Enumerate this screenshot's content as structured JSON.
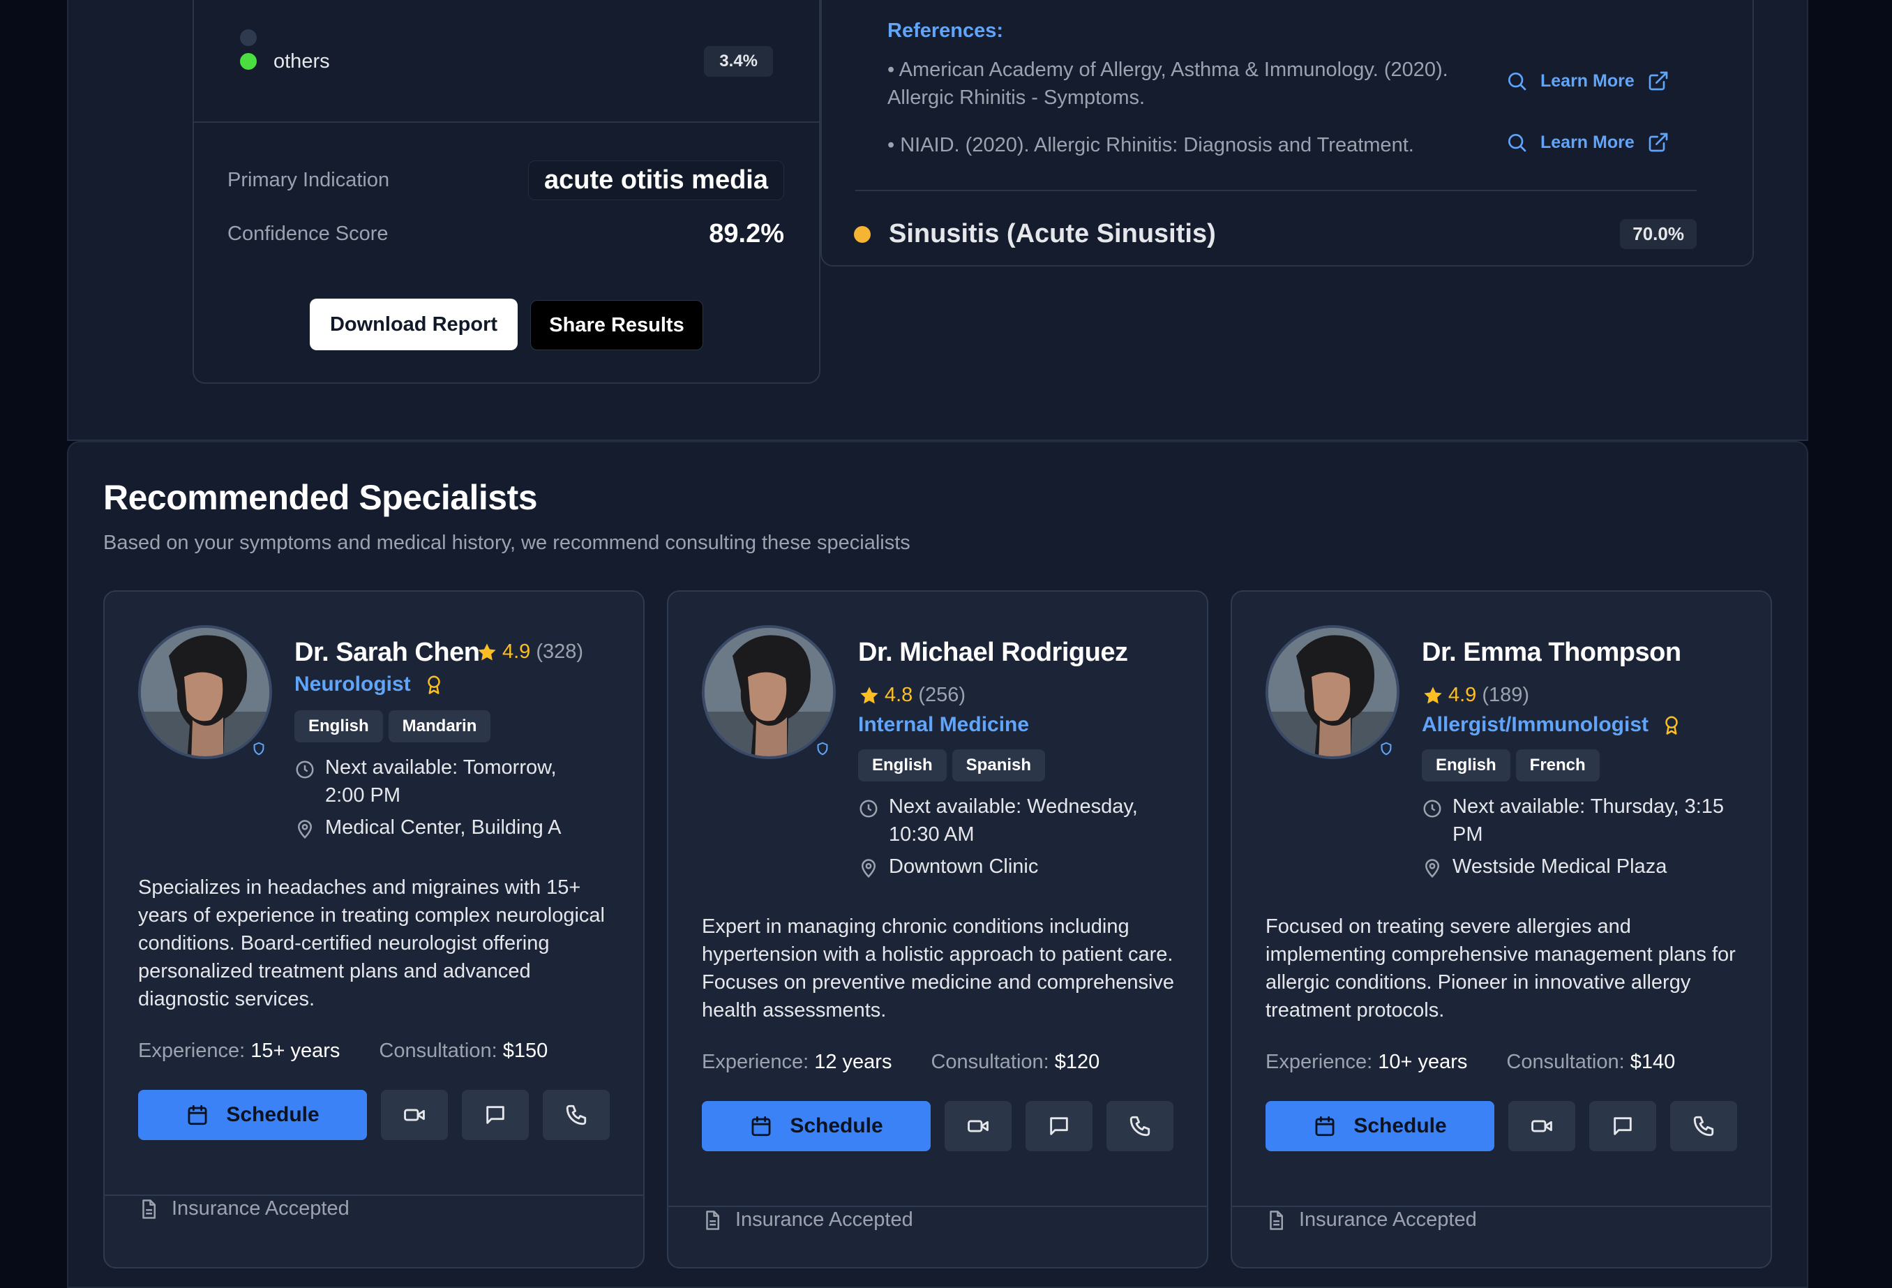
{
  "results": {
    "conditions": [
      {
        "name": "others",
        "percent": "3.4%",
        "color": "#4ade40"
      }
    ],
    "primary_indication_label": "Primary Indication",
    "primary_indication_value": "acute otitis media",
    "confidence_label": "Confidence Score",
    "confidence_value": "89.2%",
    "download_label": "Download Report",
    "share_label": "Share Results"
  },
  "references": {
    "title": "References:",
    "items": [
      {
        "text": "• American Academy of Allergy, Asthma & Immunology. (2020). Allergic Rhinitis - Symptoms.",
        "link_label": "Learn More"
      },
      {
        "text": "• NIAID. (2020). Allergic Rhinitis: Diagnosis and Treatment.",
        "link_label": "Learn More"
      }
    ],
    "next_condition": {
      "name": "Sinusitis (Acute Sinusitis)",
      "percent": "70.0%",
      "color": "#f5b533"
    }
  },
  "specialists": {
    "title": "Recommended Specialists",
    "subtitle": "Based on your symptoms and medical history, we recommend consulting these specialists",
    "doctors": [
      {
        "name": "Dr. Sarah Chen",
        "rating": "4.9",
        "reviews": "(328)",
        "specialty": "Neurologist",
        "languages": [
          "English",
          "Mandarin"
        ],
        "availability": "Next available: Tomorrow, 2:00 PM",
        "location": "Medical Center, Building A",
        "description": "Specializes in headaches and migraines with 15+ years of experience in treating complex neurological conditions. Board-certified neurologist offering personalized treatment plans and advanced diagnostic services.",
        "experience_label": "Experience:",
        "experience": "15+ years",
        "consultation_label": "Consultation:",
        "consultation": "$150",
        "schedule_label": "Schedule",
        "insurance": "Insurance Accepted"
      },
      {
        "name": "Dr. Michael Rodriguez",
        "rating": "4.8",
        "reviews": "(256)",
        "specialty": "Internal Medicine",
        "languages": [
          "English",
          "Spanish"
        ],
        "availability": "Next available: Wednesday, 10:30 AM",
        "location": "Downtown Clinic",
        "description": "Expert in managing chronic conditions including hypertension with a holistic approach to patient care. Focuses on preventive medicine and comprehensive health assessments.",
        "experience_label": "Experience:",
        "experience": "12 years",
        "consultation_label": "Consultation:",
        "consultation": "$120",
        "schedule_label": "Schedule",
        "insurance": "Insurance Accepted"
      },
      {
        "name": "Dr. Emma Thompson",
        "rating": "4.9",
        "reviews": "(189)",
        "specialty": "Allergist/Immunologist",
        "languages": [
          "English",
          "French"
        ],
        "availability": "Next available: Thursday, 3:15 PM",
        "location": "Westside Medical Plaza",
        "description": "Focused on treating severe allergies and implementing comprehensive management plans for allergic conditions. Pioneer in innovative allergy treatment protocols.",
        "experience_label": "Experience:",
        "experience": "10+ years",
        "consultation_label": "Consultation:",
        "consultation": "$140",
        "schedule_label": "Schedule",
        "insurance": "Insurance Accepted"
      }
    ]
  },
  "colors": {
    "accent": "#3b82f6",
    "link": "#60a5fa",
    "star": "#fbbf24",
    "page_bg": "#070b17",
    "panel_bg": "#141c2e",
    "card_bg": "#1c2538"
  },
  "icons": [
    "search-icon",
    "external-link-icon",
    "star-icon",
    "award-icon",
    "shield-icon",
    "clock-icon",
    "map-pin-icon",
    "calendar-icon",
    "video-icon",
    "message-icon",
    "phone-icon",
    "file-icon"
  ]
}
